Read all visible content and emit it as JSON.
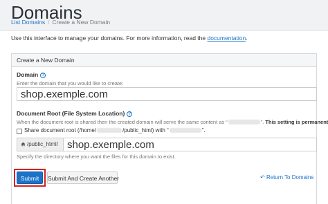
{
  "header": {
    "title": "Domains",
    "breadcrumb": {
      "link": "List Domains",
      "separator": "/",
      "current": "Create a New Domain"
    }
  },
  "intro": {
    "text": "Use this interface to manage your domains. For more information, read the ",
    "link": "documentation",
    "suffix": "."
  },
  "panel": {
    "heading": "Create a New Domain",
    "domain": {
      "label": "Domain",
      "help_icon": "?",
      "hint": "Enter the domain that you would like to create:",
      "value": "shop.exemple.com"
    },
    "docroot": {
      "label": "Document Root (File System Location)",
      "help_icon": "?",
      "hint_prefix": "When the document root is shared then the created domain will serve the same content as “",
      "hint_mid": "”.",
      "hint_bold": " This setting is permanent.",
      "share_prefix": "Share document root (/home/",
      "share_mid": "/public_html) with “",
      "share_suffix": "”.",
      "addon_label": "/public_html/",
      "value": "shop.exemple.com",
      "help_text": "Specify the directory where you want the files for this domain to exist."
    },
    "buttons": {
      "submit": "Submit",
      "submit_another": "Submit And Create Another",
      "return_icon": "↶",
      "return_label": "Return To Domains"
    }
  },
  "colors": {
    "accent": "#1a73c7",
    "highlight": "#d62020"
  },
  "icons": {
    "home": "home-icon",
    "help": "help-icon",
    "return": "return-arrow-icon"
  }
}
